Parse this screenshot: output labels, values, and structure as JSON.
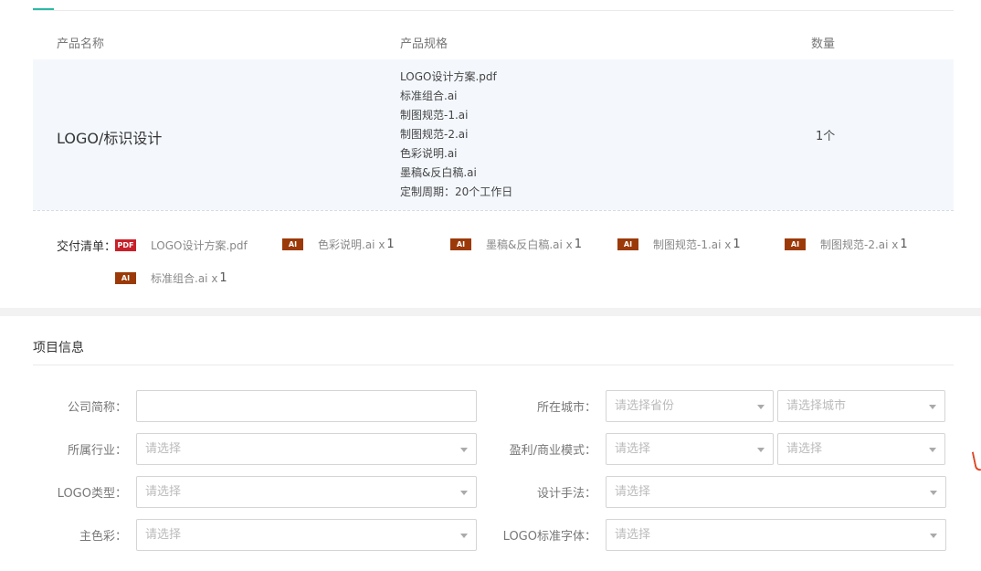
{
  "table": {
    "headers": {
      "name": "产品名称",
      "spec": "产品规格",
      "qty": "数量"
    },
    "rows": [
      {
        "name": "LOGO/标识设计",
        "specs": [
          "LOGO设计方案.pdf",
          "标准组合.ai",
          "制图规范-1.ai",
          "制图规范-2.ai",
          "色彩说明.ai",
          "墨稿&反白稿.ai",
          "定制周期：20个工作日"
        ],
        "qty": "1个"
      }
    ]
  },
  "delivery": {
    "label": "交付清单：",
    "items": [
      {
        "type": "PDF",
        "name": "LOGO设计方案.pdf",
        "count": ""
      },
      {
        "type": "AI",
        "name": "色彩说明.ai x",
        "count": "1"
      },
      {
        "type": "AI",
        "name": "墨稿&反白稿.ai x",
        "count": "1"
      },
      {
        "type": "AI",
        "name": "制图规范-1.ai x",
        "count": "1"
      },
      {
        "type": "AI",
        "name": "制图规范-2.ai x",
        "count": "1"
      },
      {
        "type": "AI",
        "name": "标准组合.ai x",
        "count": "1"
      }
    ],
    "colors": {
      "pdf": "#c8202a",
      "ai": "#9b3a08"
    }
  },
  "project": {
    "title": "项目信息",
    "fields": {
      "company": {
        "label": "公司简称：",
        "value": ""
      },
      "city": {
        "label": "所在城市：",
        "province_placeholder": "请选择省份",
        "city_placeholder": "请选择城市"
      },
      "industry": {
        "label": "所属行业：",
        "placeholder": "请选择"
      },
      "business": {
        "label": "盈利/商业模式：",
        "placeholder1": "请选择",
        "placeholder2": "请选择"
      },
      "logo_type": {
        "label": "LOGO类型：",
        "placeholder": "请选择"
      },
      "design_method": {
        "label": "设计手法：",
        "placeholder": "请选择"
      },
      "main_color": {
        "label": "主色彩：",
        "placeholder": "请选择"
      },
      "logo_font": {
        "label": "LOGO标准字体：",
        "placeholder": "请选择"
      }
    }
  },
  "accent_color": "#2ab9a8"
}
